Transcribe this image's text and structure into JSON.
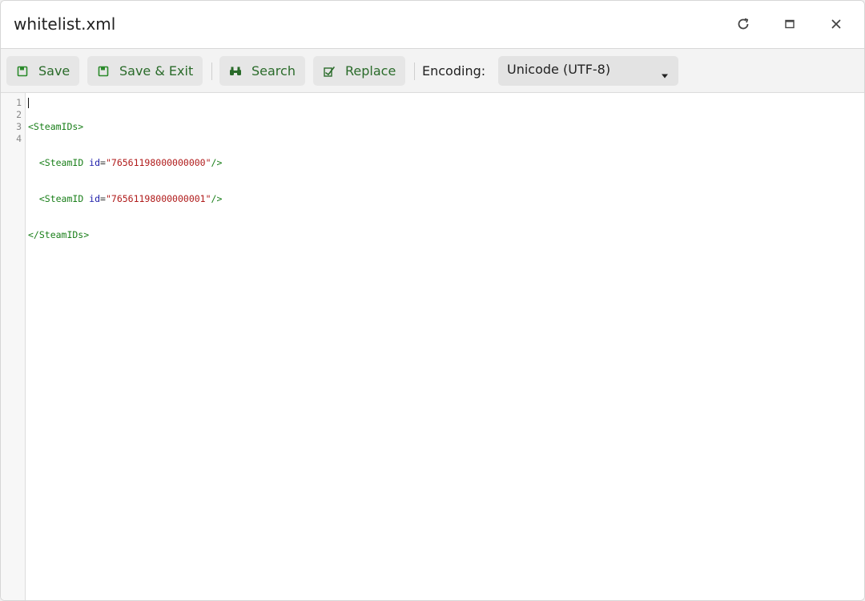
{
  "window": {
    "title": "whitelist.xml"
  },
  "controls": {
    "refresh_icon": "refresh-icon",
    "maximize_icon": "maximize-icon",
    "close_icon": "close-icon"
  },
  "toolbar": {
    "save_label": "Save",
    "save_exit_label": "Save & Exit",
    "search_label": "Search",
    "replace_label": "Replace",
    "encoding_label": "Encoding:",
    "encoding_value": "Unicode (UTF-8)",
    "accent_color": "#2a6b2a"
  },
  "editor": {
    "line_numbers": [
      "1",
      "2",
      "3",
      "4"
    ],
    "lines": [
      {
        "indent": "",
        "open": "<SteamIDs>",
        "attr": "",
        "eq": "",
        "value": "",
        "close": ""
      },
      {
        "indent": "  ",
        "open": "<SteamID ",
        "attr": "id",
        "eq": "=",
        "value": "\"76561198000000000\"",
        "close": "/>"
      },
      {
        "indent": "  ",
        "open": "<SteamID ",
        "attr": "id",
        "eq": "=",
        "value": "\"76561198000000001\"",
        "close": "/>"
      },
      {
        "indent": "",
        "open": "</SteamIDs>",
        "attr": "",
        "eq": "",
        "value": "",
        "close": ""
      }
    ]
  }
}
